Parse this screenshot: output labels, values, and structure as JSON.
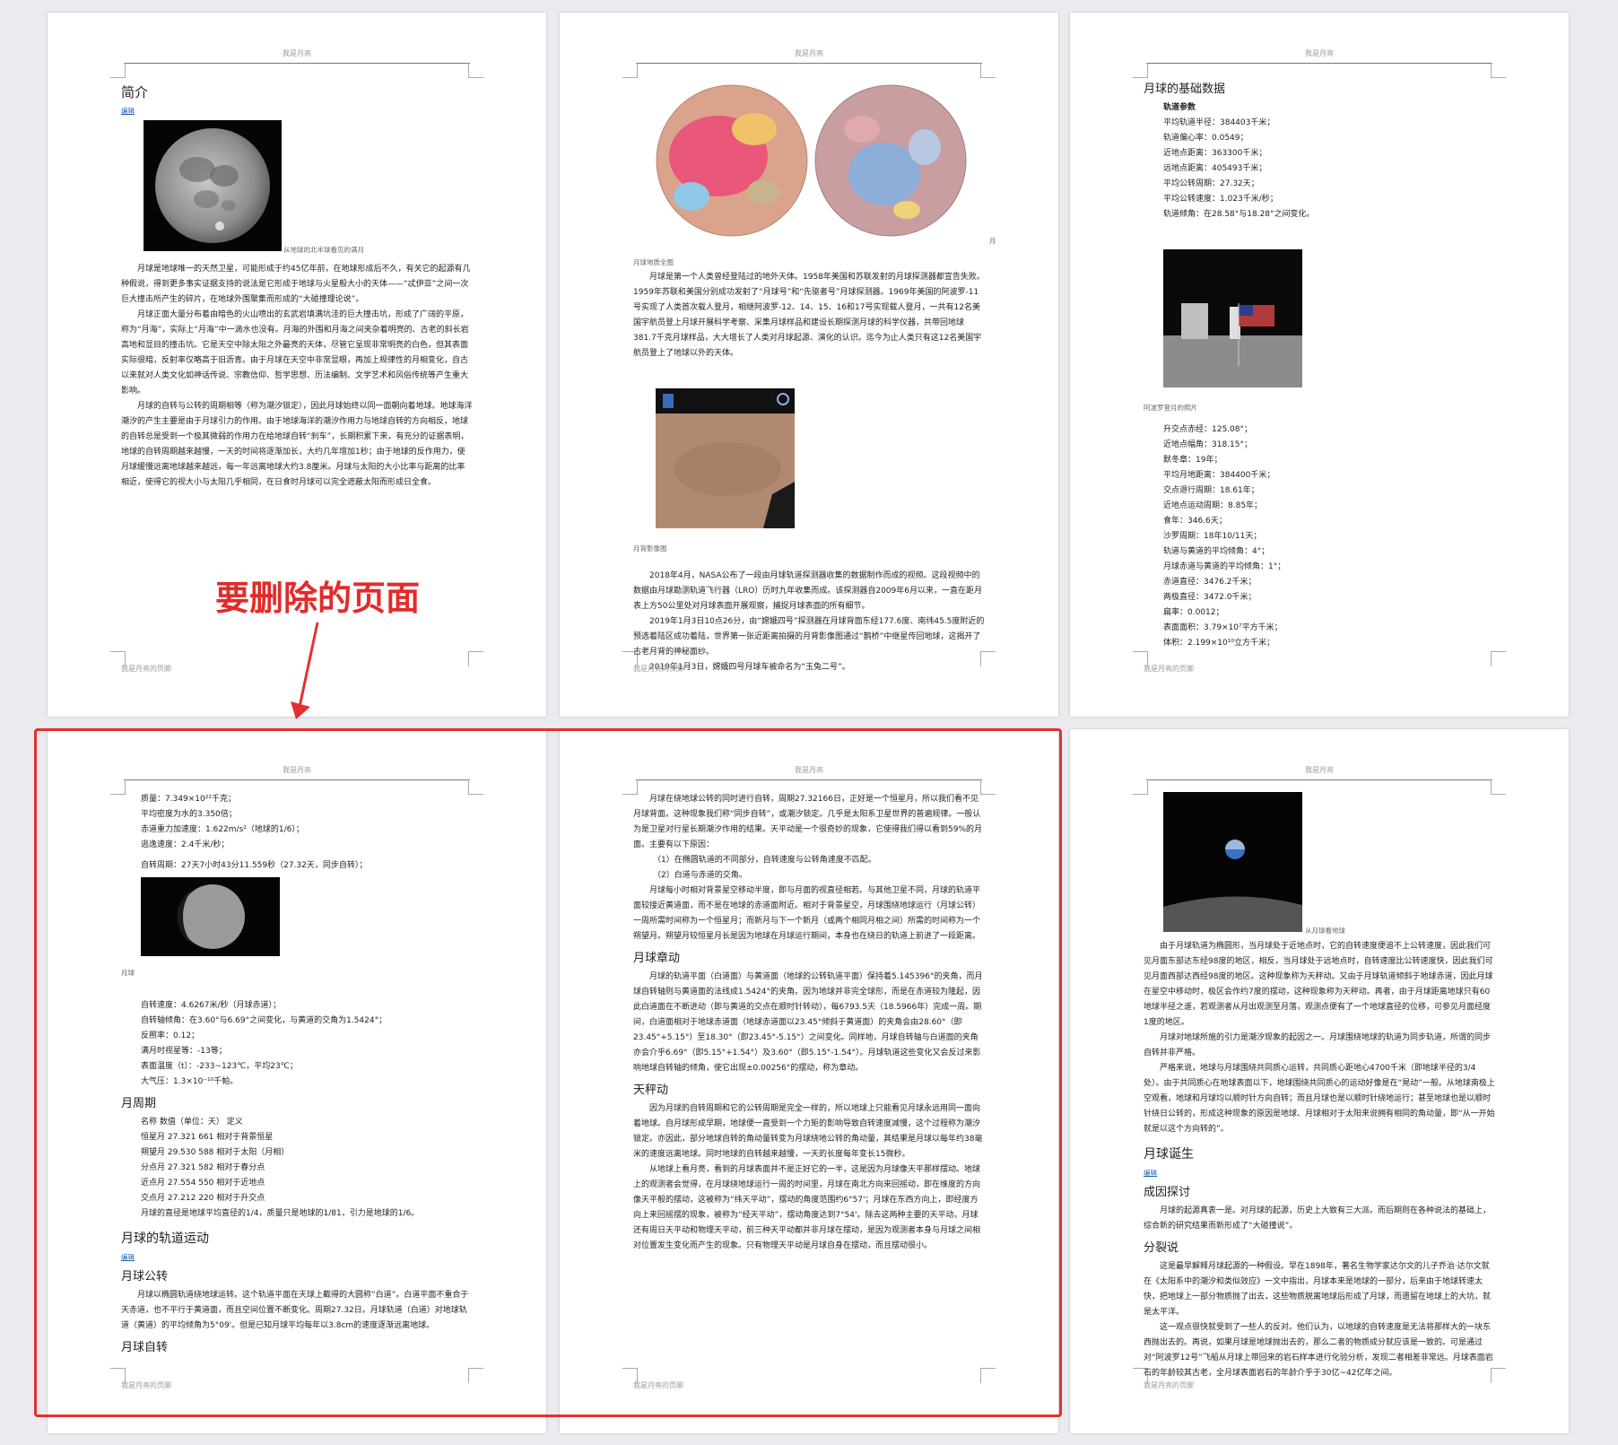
{
  "header_text": "我是月亮",
  "footer_text": "我是月亮的页脚",
  "annotation_text": "要删除的页面",
  "p1": {
    "title": "简介",
    "edit": "编辑",
    "img_caption": "从地球的北半球看见的满月",
    "para1": "月球是地球唯一的天然卫星，可能形成于约45亿年前，在地球形成后不久，有关它的起源有几种假说，得到更多事实证据支持的说法是它形成于地球与火星般大小的天体——“忒伊亚”之间一次巨大撞击所产生的碎片，在地球外围聚集而形成的“大碰撞理论说”。",
    "para2": "月球正面大量分布着由暗色的火山喷出的玄武岩填满坑洼的巨大撞击坑，形成了广阔的平原，称为“月海”，实际上“月海”中一滴水也没有。月海的外围和月海之间夹杂着明亮的、古老的斜长岩高地和显目的撞击坑。它是天空中除太阳之外最亮的天体，尽管它呈现非常明亮的白色，但其表面实际很暗，反射率仅略高于旧沥青。由于月球在天空中非常显眼，再加上规律性的月相变化，自古以来就对人类文化如神话传说、宗教信仰、哲学思想、历法编制、文学艺术和风俗传统等产生重大影响。",
    "para3": "月球的自转与公转的周期相等（称为潮汐锁定），因此月球始终以同一面朝向着地球。地球海洋潮汐的产生主要是由于月球引力的作用。由于地球海洋的潮汐作用力与地球自转的方向相反，地球的自转总是受到一个极其微弱的作用力在给地球自转“刹车”，长期积累下来，有充分的证据表明，地球的自转周期越来越慢，一天的时间将逐渐加长，大约几年增加1秒；由于地球的反作用力，使月球缓慢远离地球越来越远，每一年远离地球大约3.8厘米。月球与太阳的大小比率与距离的比率相近，使得它的视大小与太阳几乎相同，在日食时月球可以完全遮蔽太阳而形成日全食。"
  },
  "p2": {
    "img_caption": "月球地质全图",
    "moon_label": "月",
    "para1": "月球是第一个人类曾经登陆过的地外天体。1958年美国和苏联发射的月球探测器都宣告失败。1959年苏联和美国分别成功发射了“月球号”和“先驱者号”月球探测器。1969年美国的阿波罗-11号实现了人类首次载人登月，相继阿波罗-12、14、15、16和17号实现载人登月，一共有12名美国宇航员登上月球开展科学考察、采集月球样品和建设长期探测月球的科学仪器，共带回地球381.7千克月球样品，大大增长了人类对月球起源、演化的认识。迄今为止人类只有这12名美国宇航员登上了地球以外的天体。",
    "img2_caption": "月背影像图",
    "para2": "2018年4月，NASA公布了一段由月球轨道探测器收集的数据制作而成的视频。这段视频中的数据由月球勘测轨道飞行器（LRO）历时九年收集而成。该探测器自2009年6月以来，一直在距月表上方50公里处对月球表面开展观察，捕捉月球表面的所有细节。",
    "para3": "2019年1月3日10点26分，由“嫦娥四号”探测器在月球背面东经177.6度、南纬45.5度附近的预选着陆区成功着陆，世界第一张近距离拍摄的月背影像图通过“鹊桥”中继星传回地球，这揭开了古老月背的神秘面纱。",
    "para4": "2019年1月3日，嫦娥四号月球车被命名为“玉兔二号”。"
  },
  "p3": {
    "title": "月球的基础数据",
    "subtitle": "轨道参数",
    "orbit": [
      "平均轨道半径：384403千米；",
      "轨道偏心率：0.0549；",
      "近地点距离：363300千米；",
      "远地点距离：405493千米；",
      "平均公转周期：27.32天；",
      "平均公转速度：1.023千米/秒；",
      "轨道倾角：在28.58°与18.28°之间变化。"
    ],
    "img_caption": "阿波罗登月的照片",
    "orbit2": [
      "升交点赤经：125.08°；",
      "近地点幅角：318.15°；",
      "默冬章：19年；",
      "平均月地距离：384400千米；",
      "交点退行周期：18.61年；",
      "近地点运动周期：8.85年；",
      "食年：346.6天；",
      "沙罗周期：18年10/11天；",
      "轨道与黄道的平均倾角：4°；",
      "月球赤道与黄道的平均倾角：1°；",
      "赤道直径：3476.2千米；",
      "两极直径：3472.0千米；",
      "扁率：0.0012；",
      "表面面积：3.79×10⁷平方千米；",
      "体积：2.199×10¹⁰立方千米；"
    ]
  },
  "p4": {
    "list1": [
      "质量：7.349×10²²千克；",
      "平均密度为水的3.350倍；",
      "赤道重力加速度：1.622m/s²（地球的1/6）；",
      "逃逸速度：2.4千米/秒；"
    ],
    "rotation": "自转周期：27天7小时43分11.559秒（27.32天，同步自转）；",
    "img_caption": "月球",
    "list2": [
      "自转速度：4.6267米/秒（月球赤道）；",
      "自转轴倾角：在3.60°与6.69°之间变化，与黄道的交角为1.5424°；",
      "反照率：0.12；",
      "满月时视星等：-13等；",
      "表面温度（t）：-233~123℃，平均23℃；",
      "大气压：1.3×10⁻¹⁰千帕。"
    ],
    "h_period": "月周期",
    "period_header": "名称  数值（单位：天）  定义",
    "periods": [
      "恒星月 27.321 661  相对于背景恒星",
      "朔望月 29.530 588  相对于太阳（月相）",
      "分点月 27.321 582  相对于春分点",
      "近点月 27.554 550  相对于近地点",
      "交点月 27.212 220  相对于升交点"
    ],
    "period_note": "月球的直径是地球平均直径的1/4，质量只是地球的1/81，引力是地球的1/6。",
    "h_orbit": "月球的轨道运动",
    "edit": "编辑",
    "h_revolve": "月球公转",
    "revolve_para": "月球以椭圆轨道绕地球运转。这个轨道平面在天球上截得的大圆称“白道”。白道平面不重合于天赤道，也不平行于黄道面，而且空间位置不断变化。周期27.32日。月球轨道（白道）对地球轨道（黄道）的平均倾角为5°09'。但是已知月球平均每年以3.8cm的速度逐渐远离地球。",
    "h_rotate": "月球自转"
  },
  "p5": {
    "para1": "月球在绕地球公转的同时进行自转，周期27.32166日，正好是一个恒星月，所以我们看不见月球背面。这种现象我们称“同步自转”，或潮汐锁定。几乎是太阳系卫星世界的普遍规律。一般认为是卫星对行星长期潮汐作用的结果。天平动是一个很奇妙的现象，它使得我们得以看到59%的月面。主要有以下原因：",
    "reason1": "（1）在椭圆轨道的不同部分，自转速度与公转角速度不匹配。",
    "reason2": "（2）白道与赤道的交角。",
    "para2": "月球每小时相对背景星空移动半度，即与月面的视直径相若。与其他卫星不同，月球的轨道平面较接近黄道面，而不是在地球的赤道面附近。相对于背景星空，月球围绕地球运行（月球公转）一周所需时间称为一个恒星月；而新月与下一个新月（或两个相同月相之间）所需的时间称为一个朔望月。朔望月较恒星月长是因为地球在月球运行期间，本身也在绕日的轨道上前进了一段距离。",
    "h_libration": "月球章动",
    "para3": "月球的轨道平面（白道面）与黄道面（地球的公转轨道平面）保持着5.145396°的夹角，而月球自转轴则与黄道面的法线成1.5424°的夹角。因为地球并非完全球形，而是在赤道较为隆起，因此白道面在不断进动（即与黄道的交点在顺时针转动），每6793.5天（18.5966年）完成一周。期间，白道面相对于地球赤道面（地球赤道面以23.45°倾斜于黄道面）的夹角会由28.60°（即23.45°+5.15°）至18.30°（即23.45°-5.15°）之间变化。同样地，月球自转轴与白道面的夹角亦会介乎6.69°（即5.15°+1.54°）及3.60°（即5.15°-1.54°）。月球轨道这些变化又会反过来影响地球自转轴的倾角，使它出现±0.00256°的摆动，称为章动。",
    "h_balance": "天秤动",
    "para4": "因为月球的自转周期和它的公转周期是完全一样的，所以地球上只能看见月球永远用同一面向着地球。自月球形成早期，地球便一直受到一个力矩的影响导致自转速度减慢，这个过程称为潮汐锁定。亦因此，部分地球自转的角动量转变为月球绕地公转的角动量，其结果是月球以每年约38毫米的速度远离地球。同时地球的自转越来越慢，一天的长度每年变长15微秒。",
    "para5": "从地球上看月亮，看到的月球表面并不是正好它的一半，这是因为月球像天平那样摆动。地球上的观测者会觉得，在月球绕地球运行一周的时间里，月球在南北方向来回摇动，即在维度的方向像天平般的摆动，这被称为“纬天平动”，摆动的角度范围约6°57'；月球在东西方向上，即经度方向上来回摇摆的现象，被称为“经天平动”，摆动角度达到7°54'。除去这两种主要的天平动，月球还有周日天平动和物理天平动，前三种天平动都并非月球在摆动，是因为观测者本身与月球之间相对位置发生变化而产生的现象。只有物理天平动是月球自身在摆动，而且摆动很小。"
  },
  "p6": {
    "img_caption": "从月球看地球",
    "para1": "由于月球轨道为椭圆形，当月球处于近地点时，它的自转速度便追不上公转速度，因此我们可见月面东部达东经98度的地区，相反，当月球处于远地点时，自转速度比公转速度快，因此我们可见月面西部达西经98度的地区。这种现象称为天秤动。又由于月球轨道倾斜于地球赤道，因此月球在星空中移动时，极区会作约7度的摆动，这种现象称为天秤动。再者，由于月球距离地球只有60地球半径之遥，若观测者从月出观测至月落，观测点便有了一个地球直径的位移，可参见月面经度1度的地区。",
    "para2": "月球对地球所施的引力是潮汐现象的起因之一。月球围绕地球的轨道为同步轨道，所谓的同步自转并非严格。",
    "para3": "严格来说，地球与月球围绕共同质心运转，共同质心距地心4700千米（即地球半径的3/4处）。由于共同质心在地球表面以下，地球围绕共同质心的运动好像是在“晃动”一般。从地球南极上空观看，地球和月球均以顺时针方向自转；而且月球也是以顺时针绕地运行；甚至地球也是以顺时针绕日公转的，形成这种现象的原因是地球、月球相对于太阳来说拥有相同的角动量，即“从一开始就是以这个方向转的”。",
    "h_birth": "月球诞生",
    "edit": "编辑",
    "h_cause": "成因探讨",
    "para4": "月球的起源真衷一是。对月球的起源，历史上大致有三大派。而后期则在各种说法的基础上，综合新的研究结果而新形成了“大碰撞说”。",
    "h_split": "分裂说",
    "para5": "这是最早解释月球起源的一种假设。早在1898年，著名生物学家达尔文的儿子乔治·达尔文就在《太阳系中的潮汐和类似效应》一文中指出，月球本来是地球的一部分，后来由于地球转速太快，把地球上一部分物质抛了出去，这些物质脱离地球后形成了月球，而遗留在地球上的大坑，就是太平洋。",
    "para6": "这一观点很快就受到了一些人的反对。他们认为，以地球的自转速度是无法将那样大的一块东西抛出去的。再说，如果月球是地球抛出去的，那么二者的物质成分就应该是一致的。可是通过对“阿波罗12号”飞船从月球上带回来的岩石样本进行化验分析，发现二者相差非常远。月球表面岩石的年龄较其古老，全月球表面岩石的年龄介乎于30亿~42亿年之间。"
  }
}
